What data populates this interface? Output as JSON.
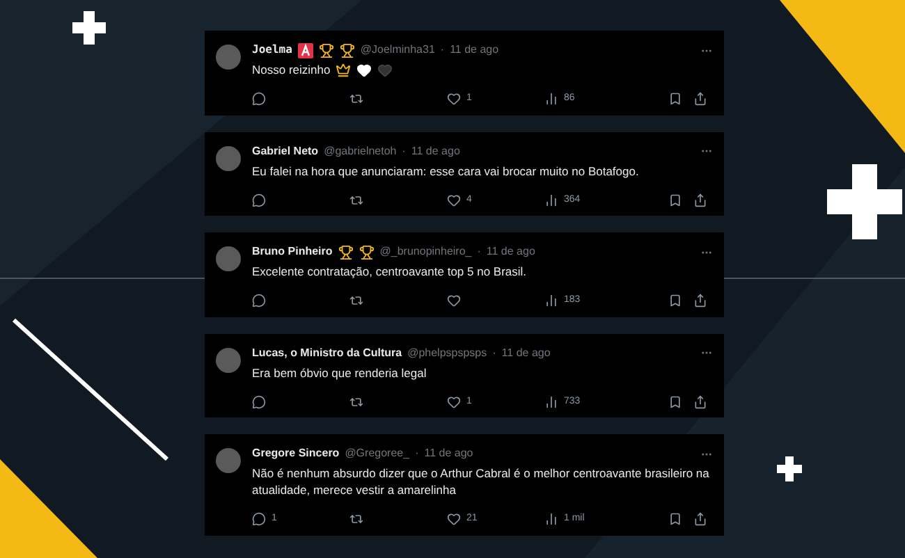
{
  "tweets": [
    {
      "name": "Joelma",
      "kind": "mono",
      "badges": [
        {
          "kind": "letter"
        },
        {
          "kind": "trophy"
        },
        {
          "kind": "trophy"
        }
      ],
      "handle": "@Joelminha31",
      "separator": "·",
      "time": "11 de ago",
      "text": "Nosso reizinho",
      "emojis": [
        {
          "kind": "crown"
        },
        {
          "kind": "white-heart"
        },
        {
          "kind": "black-heart"
        }
      ],
      "likes": "1",
      "views": "86"
    },
    {
      "name": "Gabriel Neto",
      "kind": "sans",
      "handle": "@gabrielnetoh",
      "separator": "·",
      "time": "11 de ago",
      "text": "Eu falei na hora que anunciaram: esse cara vai brocar muito no Botafogo.",
      "likes": "4",
      "views": "364"
    },
    {
      "name": "Bruno Pinheiro",
      "kind": "sans",
      "badges": [
        {
          "kind": "trophy"
        },
        {
          "kind": "trophy"
        }
      ],
      "handle": "@_brunopinheiro_",
      "separator": "·",
      "time": "11 de ago",
      "text": "Excelente contratação, centroavante top 5 no Brasil.",
      "views": "183"
    },
    {
      "name": "Lucas, o Ministro da Cultura",
      "kind": "sans",
      "handle": "@phelpspspsps",
      "separator": "·",
      "time": "11 de ago",
      "text": "Era bem óbvio que renderia legal",
      "likes": "1",
      "views": "733"
    },
    {
      "name": "Gregore Sincero",
      "kind": "sans",
      "handle": "@Gregoree_",
      "separator": "·",
      "time": "11 de ago",
      "text": "Não é nenhum absurdo dizer que o Arthur Cabral é o melhor centroavante brasileiro na atualidade, merece vestir a amarelinha",
      "replies": "1",
      "likes": "21",
      "views": "1 mil"
    }
  ]
}
